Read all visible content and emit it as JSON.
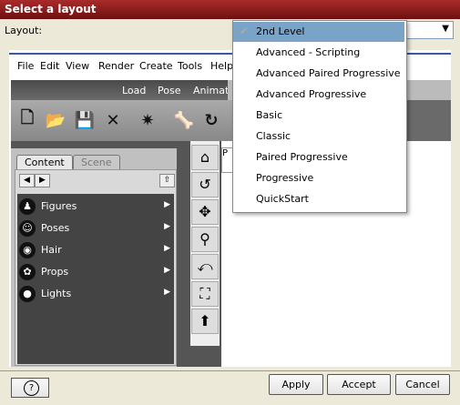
{
  "dialog": {
    "title": "Select a layout"
  },
  "layout_field": {
    "label": "Layout:",
    "selected": "2nd Level"
  },
  "preview": {
    "menu": [
      "File",
      "Edit",
      "View",
      "Render",
      "Create",
      "Tools",
      "Help"
    ],
    "top_tabs": [
      "Load",
      "Pose",
      "Animate"
    ],
    "panel_tabs": {
      "active": "Content",
      "inactive": "Scene"
    },
    "categories": [
      {
        "label": "Figures",
        "icon": "figure-icon"
      },
      {
        "label": "Poses",
        "icon": "pose-icon"
      },
      {
        "label": "Hair",
        "icon": "hair-icon"
      },
      {
        "label": "Props",
        "icon": "props-icon"
      },
      {
        "label": "Lights",
        "icon": "lights-icon"
      }
    ],
    "viewport_tab": "P"
  },
  "dropdown": {
    "items": [
      "2nd Level",
      "Advanced - Scripting",
      "Advanced Paired Progressive",
      "Advanced Progressive",
      "Basic",
      "Classic",
      "Paired Progressive",
      "Progressive",
      "QuickStart"
    ],
    "selected_index": 0
  },
  "buttons": {
    "help": "?",
    "apply": "Apply",
    "accept": "Accept",
    "cancel": "Cancel"
  },
  "colors": {
    "titlebar": "#a92b2b",
    "selected_item": "#7aa3c8"
  }
}
